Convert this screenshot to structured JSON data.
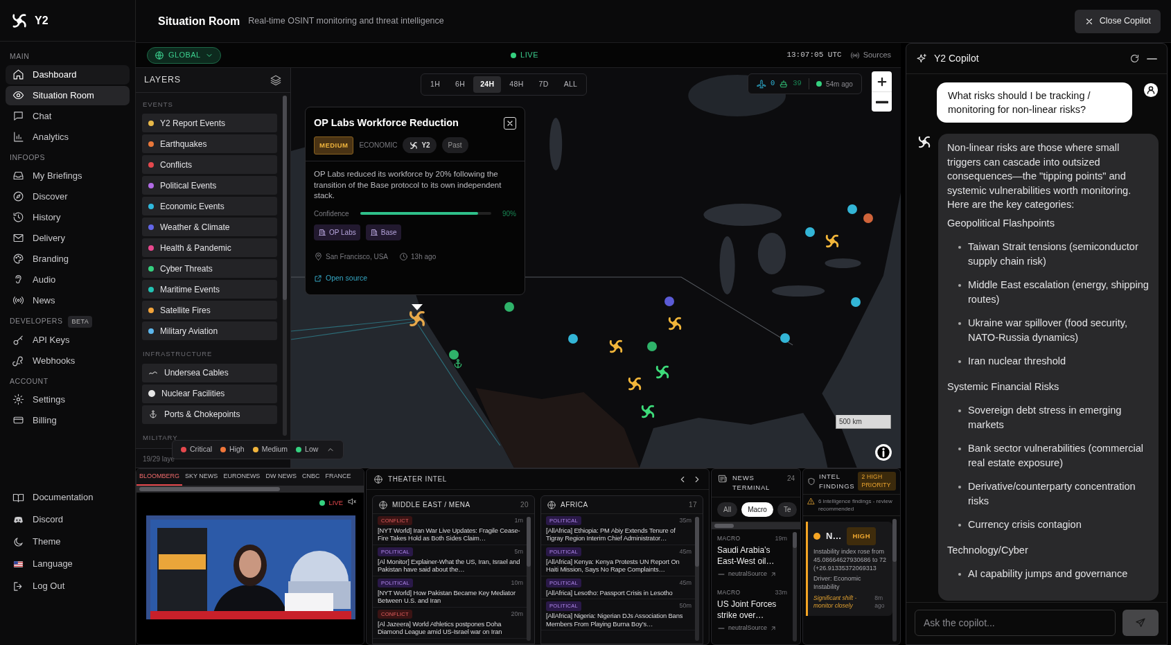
{
  "brand": {
    "name": "Y2"
  },
  "sidebar": {
    "sections": [
      {
        "heading": "MAIN",
        "items": [
          {
            "label": "Dashboard",
            "selected": false,
            "hovered": true
          },
          {
            "label": "Situation Room",
            "selected": true,
            "hovered": false
          },
          {
            "label": "Chat",
            "selected": false,
            "hovered": false
          },
          {
            "label": "Analytics",
            "selected": false,
            "hovered": false
          }
        ]
      },
      {
        "heading": "INFOOPS",
        "items": [
          {
            "label": "My Briefings",
            "selected": false,
            "hovered": false
          },
          {
            "label": "Discover",
            "selected": false,
            "hovered": false
          },
          {
            "label": "History",
            "selected": false,
            "hovered": false
          },
          {
            "label": "Delivery",
            "selected": false,
            "hovered": false
          },
          {
            "label": "Branding",
            "selected": false,
            "hovered": false
          },
          {
            "label": "Audio",
            "selected": false,
            "hovered": false
          },
          {
            "label": "News",
            "selected": false,
            "hovered": false
          }
        ]
      },
      {
        "heading": "DEVELOPERS",
        "badge": "BETA",
        "items": [
          {
            "label": "API Keys",
            "selected": false,
            "hovered": false
          },
          {
            "label": "Webhooks",
            "selected": false,
            "hovered": false
          }
        ]
      },
      {
        "heading": "ACCOUNT",
        "items": [
          {
            "label": "Settings",
            "selected": false,
            "hovered": false
          },
          {
            "label": "Billing",
            "selected": false,
            "hovered": false
          }
        ]
      }
    ],
    "footer_items": [
      {
        "label": "Documentation"
      },
      {
        "label": "Discord"
      },
      {
        "label": "Theme"
      },
      {
        "label": "Language"
      },
      {
        "label": "Log Out"
      }
    ]
  },
  "header": {
    "title": "Situation Room",
    "subtitle": "Real-time OSINT monitoring and threat intelligence",
    "close_button": "Close Copilot"
  },
  "map_toolbar": {
    "region": "GLOBAL",
    "live": "LIVE",
    "time": "13:07:05 UTC",
    "sources": "Sources"
  },
  "layers": {
    "title": "LAYERS",
    "groups": [
      {
        "heading": "EVENTS",
        "items": [
          {
            "label": "Y2 Report Events",
            "kind": "dot",
            "color": "#e9b949"
          },
          {
            "label": "Earthquakes",
            "kind": "dot",
            "color": "#e9773a"
          },
          {
            "label": "Conflicts",
            "kind": "dot",
            "color": "#e5484d"
          },
          {
            "label": "Political Events",
            "kind": "dot",
            "color": "#b26be6"
          },
          {
            "label": "Economic Events",
            "kind": "dot",
            "color": "#2fb8dc"
          },
          {
            "label": "Weather & Climate",
            "kind": "dot",
            "color": "#6366e8"
          },
          {
            "label": "Health & Pandemic",
            "kind": "dot",
            "color": "#e8488e"
          },
          {
            "label": "Cyber Threats",
            "kind": "dot",
            "color": "#35d07f"
          },
          {
            "label": "Maritime Events",
            "kind": "dot",
            "color": "#22c3b4"
          },
          {
            "label": "Satellite Fires",
            "kind": "dot",
            "color": "#f2a33a"
          },
          {
            "label": "Military Aviation",
            "kind": "dot",
            "color": "#5cb6ec"
          }
        ]
      },
      {
        "heading": "INFRASTRUCTURE",
        "items": [
          {
            "label": "Undersea Cables",
            "kind": "cable"
          },
          {
            "label": "Nuclear Facilities",
            "kind": "nuclear"
          },
          {
            "label": "Ports & Chokepoints",
            "kind": "port"
          }
        ]
      },
      {
        "heading": "MILITARY"
      }
    ],
    "footer": "19/29 laye"
  },
  "legend": [
    {
      "label": "Critical",
      "color": "#e5484d"
    },
    {
      "label": "High",
      "color": "#f0763a"
    },
    {
      "label": "Medium",
      "color": "#f0b43c"
    },
    {
      "label": "Low",
      "color": "#35d07f"
    }
  ],
  "time_ranges": [
    {
      "label": "1H",
      "selected": false
    },
    {
      "label": "6H",
      "selected": false
    },
    {
      "label": "24H",
      "selected": true
    },
    {
      "label": "48H",
      "selected": false
    },
    {
      "label": "7D",
      "selected": false
    },
    {
      "label": "ALL",
      "selected": false
    }
  ],
  "map_status": {
    "flights": "0",
    "vessels": "39",
    "updated": "54m ago"
  },
  "scale": "500 km",
  "markers": [
    {
      "kind": "swirl",
      "color": "#e8a94a",
      "selected": true
    },
    {
      "kind": "dot",
      "color": "#2fb36a",
      "selected": false
    },
    {
      "kind": "dot",
      "color": "#2fb36a",
      "selected": false
    },
    {
      "kind": "port",
      "selected": false
    },
    {
      "kind": "dot",
      "color": "#33b5d6",
      "selected": false
    },
    {
      "kind": "dot",
      "color": "#5b5bd6",
      "selected": false
    },
    {
      "kind": "swirl",
      "color": "#f2b63a",
      "selected": false
    },
    {
      "kind": "swirl",
      "color": "#f2b63a",
      "selected": false
    },
    {
      "kind": "dot",
      "color": "#2fb36a",
      "selected": false
    },
    {
      "kind": "swirl",
      "color": "#3ddc7a",
      "selected": false
    },
    {
      "kind": "swirl",
      "color": "#f2b63a",
      "selected": false
    },
    {
      "kind": "swirl",
      "color": "#3ddc7a",
      "selected": false
    },
    {
      "kind": "dot",
      "color": "#33b5d6",
      "selected": false
    },
    {
      "kind": "dot",
      "color": "#33b5d6",
      "selected": false
    },
    {
      "kind": "swirl",
      "color": "#f2b63a",
      "selected": false
    },
    {
      "kind": "dot",
      "color": "#33b5d6",
      "selected": false
    },
    {
      "kind": "dot",
      "color": "#d0643a",
      "selected": false
    },
    {
      "kind": "dot",
      "color": "#33b5d6",
      "selected": false
    }
  ],
  "popup": {
    "title": "OP Labs Workforce Reduction",
    "severity": {
      "label": "MEDIUM",
      "kind": "medium"
    },
    "category": "ECONOMIC",
    "source": "Y2",
    "timing": "Past",
    "description": "OP Labs reduced its workforce by 20% following the transition of the Base protocol to its own independent stack.",
    "confidence_label": "Confidence",
    "confidence": {
      "level": 0.9,
      "reading": "90%"
    },
    "entities": [
      "OP Labs",
      "Base"
    ],
    "location": "San Francisco, USA",
    "time": "13h ago",
    "link": "Open source"
  },
  "news_video": {
    "channels": [
      {
        "label": "BLOOMBERG",
        "selected": true
      },
      {
        "label": "SKY NEWS",
        "selected": false
      },
      {
        "label": "EURONEWS",
        "selected": false
      },
      {
        "label": "DW NEWS",
        "selected": false
      },
      {
        "label": "CNBC",
        "selected": false
      },
      {
        "label": "FRANCE",
        "selected": false
      }
    ],
    "live": "LIVE",
    "muted": true
  },
  "theater_intel": {
    "title": "THEATER INTEL",
    "regions": [
      {
        "name": "MIDDLE EAST / MENA",
        "count": "20",
        "items": [
          {
            "kind": "conflict",
            "tag": "CONFLICT",
            "time": "1m",
            "text": "[NYT World] Iran War Live Updates: Fragile Cease-Fire Takes Hold as Both Sides Claim…"
          },
          {
            "kind": "political",
            "tag": "POLITICAL",
            "time": "5m",
            "text": "[Al Monitor] Explainer-What the US, Iran, Israel and Pakistan have said about the…"
          },
          {
            "kind": "political",
            "tag": "POLITICAL",
            "time": "10m",
            "text": "[NYT World] How Pakistan Became Key Mediator Between U.S. and Iran"
          },
          {
            "kind": "conflict",
            "tag": "CONFLICT",
            "time": "20m",
            "text": "[Al Jazeera] World Athletics postpones Doha Diamond League amid US-Israel war on Iran"
          }
        ]
      },
      {
        "name": "AFRICA",
        "count": "17",
        "items": [
          {
            "kind": "political",
            "tag": "POLITICAL",
            "time": "35m",
            "text": "[AllAfrica] Ethiopia: PM Abiy Extends Tenure of Tigray Region Interim Chief Administrator…"
          },
          {
            "kind": "political",
            "tag": "POLITICAL",
            "time": "45m",
            "text": "[AllAfrica] Kenya: Kenya Protests UN Report On Haiti Mission, Says No Rape Complaints…"
          },
          {
            "kind": "political",
            "tag": "POLITICAL",
            "time": "45m",
            "text": "[AllAfrica] Lesotho: Passport Crisis in Lesotho"
          },
          {
            "kind": "political",
            "tag": "POLITICAL",
            "time": "50m",
            "text": "[AllAfrica] Nigeria: Nigerian DJs Association Bans Members From Playing Burna Boy’s…"
          }
        ]
      }
    ]
  },
  "news_terminal": {
    "title": "NEWS TERMINAL",
    "count": "24",
    "filters": [
      {
        "label": "All",
        "selected": false
      },
      {
        "label": "Macro",
        "selected": true
      },
      {
        "label": "Te",
        "selected": false
      }
    ],
    "items": [
      {
        "category": "MACRO",
        "time": "19m",
        "headline": "Saudi Arabia’s East-West oil…",
        "source": "neutralSource"
      },
      {
        "category": "MACRO",
        "time": "33m",
        "headline": "US Joint Forces strike over…",
        "source": "neutralSource"
      }
    ]
  },
  "intel_findings": {
    "title": "INTEL FINDINGS",
    "badge": "2 HIGH PRIORITY",
    "notice": "6 intelligence findings - review recommended",
    "findings": [
      {
        "title": "N…",
        "severity": {
          "label": "HIGH",
          "kind": "high"
        },
        "color": "#f5a524",
        "detail": "Instability index rose from 45.08664627930686 to 72 (+26.91335372069313",
        "driver": "Driver: Economic Instability",
        "note": "Significant shift - monitor closely",
        "time": "8m ago"
      }
    ]
  },
  "copilot": {
    "title": "Y2 Copilot",
    "user_message": "What risks should I be tracking / monitoring for non-linear risks?",
    "assistant_message": {
      "intro": "Non-linear risks are those where small triggers can cascade into outsized consequences—the \"tipping points\" and systemic vulnerabilities worth monitoring. Here are the key categories:",
      "sections": [
        {
          "heading": "Geopolitical Flashpoints",
          "bullets": [
            "Taiwan Strait tensions (semiconductor supply chain risk)",
            "Middle East escalation (energy, shipping routes)",
            "Ukraine war spillover (food security, NATO-Russia dynamics)",
            "Iran nuclear threshold"
          ]
        },
        {
          "heading": "Systemic Financial Risks",
          "bullets": [
            "Sovereign debt stress in emerging markets",
            "Bank sector vulnerabilities (commercial real estate exposure)",
            "Derivative/counterparty concentration risks",
            "Currency crisis contagion"
          ]
        },
        {
          "heading": "Technology/Cyber",
          "bullets": [
            "AI capability jumps and governance"
          ]
        }
      ]
    },
    "placeholder": "Ask the copilot...",
    "send_button": {
      "disabled": true
    }
  }
}
